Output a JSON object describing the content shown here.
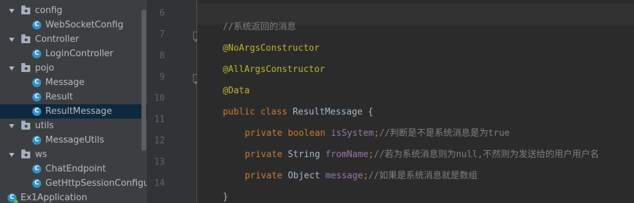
{
  "tree": {
    "items": [
      {
        "type": "folder",
        "label": "config"
      },
      {
        "type": "class",
        "label": "WebSocketConfig"
      },
      {
        "type": "folder",
        "label": "Controller"
      },
      {
        "type": "class",
        "label": "LoginController"
      },
      {
        "type": "folder",
        "label": "pojo"
      },
      {
        "type": "class",
        "label": "Message"
      },
      {
        "type": "class",
        "label": "Result"
      },
      {
        "type": "class",
        "label": "ResultMessage",
        "selected": true
      },
      {
        "type": "folder",
        "label": "utils"
      },
      {
        "type": "class",
        "label": "MessageUtils"
      },
      {
        "type": "folder",
        "label": "ws"
      },
      {
        "type": "class",
        "label": "ChatEndpoint"
      },
      {
        "type": "class",
        "label": "GetHttpSessionConfigurat"
      },
      {
        "type": "app",
        "label": "Ex1Application"
      }
    ],
    "class_badge": "C"
  },
  "gutter": {
    "line_numbers": [
      "6",
      "7",
      "8",
      "9",
      "10",
      "11",
      "12",
      "13",
      "14"
    ]
  },
  "code": {
    "line6": {
      "comment": "//系统返回的消息"
    },
    "line7": {
      "annotation": "@NoArgsConstructor"
    },
    "line8": {
      "annotation": "@AllArgsConstructor"
    },
    "line9": {
      "annotation": "@Data"
    },
    "line10": {
      "kw1": "public",
      "kw2": "class",
      "name": "ResultMessage",
      "brace": "{"
    },
    "line11": {
      "kw1": "private",
      "type": "boolean",
      "field": "isSystem",
      "semi": ";",
      "comment": "//判断是不是系统消息是为true"
    },
    "line12": {
      "kw1": "private",
      "type": "String",
      "field": "fromName",
      "semi": ";",
      "comment": "//若为系统消息则为null,不然则为发送给的用户用户名"
    },
    "line13": {
      "kw1": "private",
      "type": "Object",
      "field": "message",
      "semi": ";",
      "comment": "//如果是系统消息就是数组"
    },
    "line14": {
      "brace": "}"
    }
  },
  "colors": {
    "keyword": "#cc7832",
    "annotation": "#bbb529",
    "comment": "#808080",
    "field": "#9876aa",
    "selection": "#0d293e"
  }
}
